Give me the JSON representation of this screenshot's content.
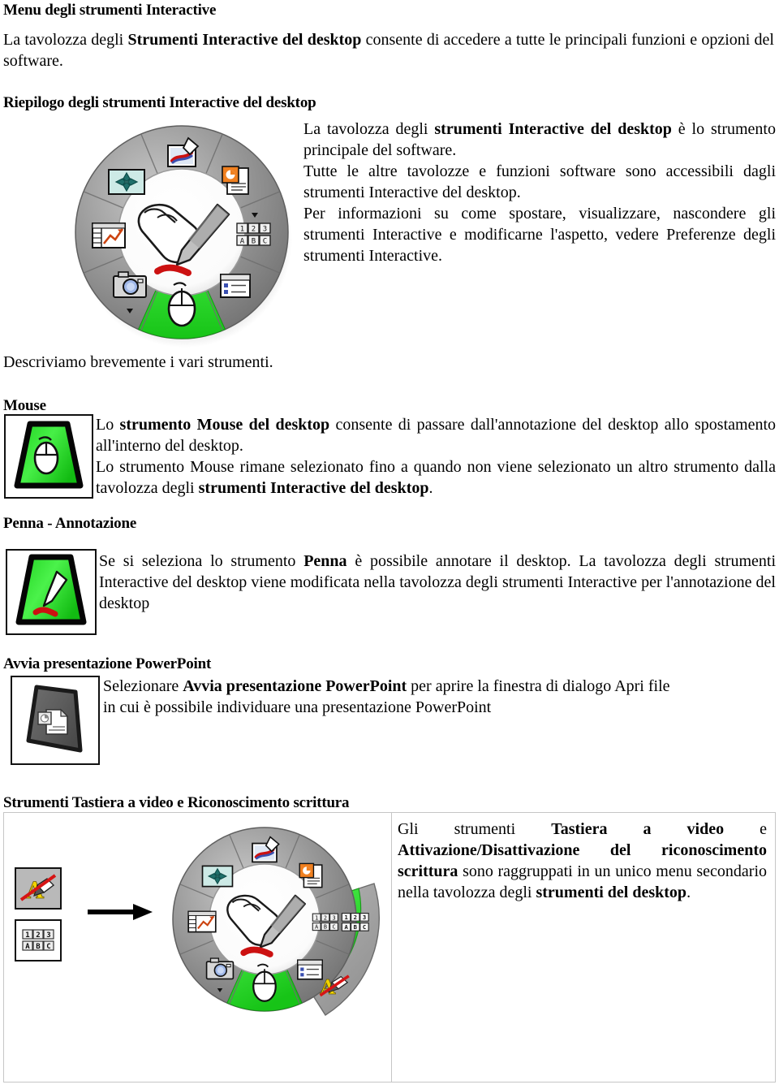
{
  "document": {
    "title": "Menu degli strumenti Interactive",
    "intro": {
      "prefix": "La tavolozza degli ",
      "bold1": "Strumenti Interactive del desktop",
      "suffix": " consente di accedere a tutte le principali funzioni e opzioni del software."
    },
    "sections": [
      {
        "id": "riepilogo",
        "heading": "Riepilogo degli strumenti Interactive del desktop",
        "image": "tool-wheel-palette",
        "paragraphs": [
          {
            "p1": "La tavolozza degli ",
            "b1": "strumenti Interactive del desktop",
            "p2": " è lo strumento principale del software."
          },
          {
            "p1": "Tutte le altre tavolozze e funzioni software sono accessibili dagli strumenti Interactive del desktop."
          },
          {
            "p1": "Per informazioni su come spostare, visualizzare, nascondere gli strumenti Interactive e modificarne l'aspetto, vedere Preferenze degli strumenti Interactive."
          }
        ]
      },
      {
        "id": "descriviamo",
        "text": "Descriviamo brevemente i vari strumenti."
      },
      {
        "id": "mouse",
        "heading": "Mouse",
        "image": "mouse-tool-icon",
        "body": {
          "p1": "Lo ",
          "b1": "strumento Mouse del desktop",
          "p2": " consente di passare dall'annotazione del desktop allo spostamento all'interno del desktop.",
          "p3": "Lo strumento Mouse rimane selezionato fino a quando non viene selezionato un altro strumento dalla tavolozza degli ",
          "b2": "strumenti Interactive del desktop",
          "p4": "."
        }
      },
      {
        "id": "penna",
        "heading": "Penna - Annotazione",
        "image": "pen-tool-icon",
        "body": {
          "p1": "Se si seleziona lo strumento ",
          "b1": "Penna",
          "p2": " è possibile annotare il desktop. La tavolozza degli strumenti Interactive del desktop viene modificata nella tavolozza degli strumenti Interactive per l'annotazione del desktop"
        }
      },
      {
        "id": "powerpoint",
        "heading": "Avvia presentazione PowerPoint",
        "image": "powerpoint-tool-icon",
        "body": {
          "p1": "Selezionare ",
          "b1": "Avvia presentazione PowerPoint",
          "p2": " per aprire la finestra di dialogo Apri file in cui è possibile individuare una presentazione PowerPoint"
        }
      },
      {
        "id": "tastiera",
        "heading": "Strumenti Tastiera a video e Riconoscimento scrittura",
        "table": {
          "left_cell": {
            "icons": [
              "handwriting-recognition-toggle-icon",
              "on-screen-keyboard-icon"
            ],
            "arrow": "right-arrow",
            "image": "tool-wheel-palette-expanded"
          },
          "right_cell": {
            "p1": "Gli strumenti ",
            "b1": "Tastiera a video",
            "p2": " e ",
            "b2": "Attivazione/Disattivazione del riconoscimento scrittura",
            "p3": " sono raggruppati in un unico menu secondario nella tavolozza degli ",
            "b3": "strumenti del desktop",
            "p4": "."
          }
        }
      }
    ]
  },
  "colors": {
    "wheel_ring": "#8a8a8a",
    "wheel_ring_light": "#a8a8a8",
    "wheel_highlight_green": "#2ee02e",
    "wheel_center": "#ffffff",
    "accent_red": "#cc1111",
    "accent_orange": "#f08020",
    "table_border": "#c6c6c6",
    "text": "#000000"
  },
  "wheel_segments": [
    {
      "name": "screen-capture-note",
      "position": "top",
      "state": "normal"
    },
    {
      "name": "powerpoint",
      "position": "top-right",
      "state": "normal"
    },
    {
      "name": "keyboard-handwriting",
      "position": "right",
      "state": "normal"
    },
    {
      "name": "list-menu",
      "position": "bottom-right",
      "state": "normal"
    },
    {
      "name": "mouse",
      "position": "bottom",
      "state": "selected"
    },
    {
      "name": "camera",
      "position": "bottom-left",
      "state": "normal"
    },
    {
      "name": "chart",
      "position": "left",
      "state": "normal"
    },
    {
      "name": "move",
      "position": "top-left",
      "state": "normal"
    }
  ]
}
